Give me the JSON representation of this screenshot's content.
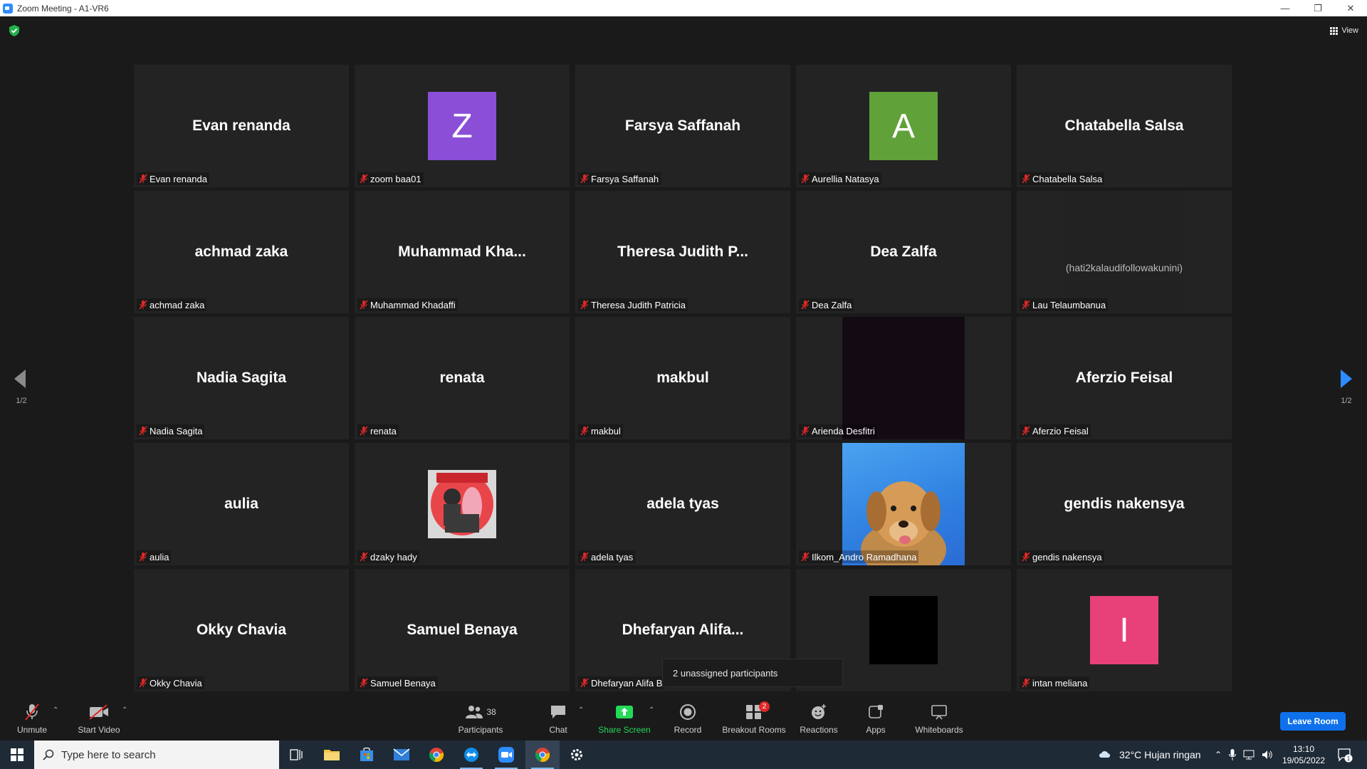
{
  "window": {
    "title": "Zoom Meeting - A1-VR6"
  },
  "top": {
    "view_label": "View"
  },
  "pager": {
    "left_count": "1/2",
    "right_count": "1/2"
  },
  "tiles": [
    {
      "big": "Evan renanda",
      "tag": "Evan renanda"
    },
    {
      "avatar_letter": "Z",
      "avatar_color": "#8a4fd6",
      "tag": "zoom baa01"
    },
    {
      "big": "Farsya Saffanah",
      "tag": "Farsya Saffanah"
    },
    {
      "avatar_letter": "A",
      "avatar_color": "#61a13a",
      "tag": "Aurellia Natasya"
    },
    {
      "big": "Chatabella Salsa",
      "tag": "Chatabella Salsa"
    },
    {
      "big": "achmad zaka",
      "tag": "achmad zaka"
    },
    {
      "big": "Muhammad  Kha...",
      "tag": "Muhammad Khadaffi"
    },
    {
      "big": "Theresa Judith P...",
      "tag": "Theresa Judith Patricia"
    },
    {
      "big": "Dea Zalfa",
      "tag": "Dea Zalfa"
    },
    {
      "video_text": "(hati2kalaudifollowakunini)",
      "tag": "Lau Telaumbanua"
    },
    {
      "big": "Nadia Sagita",
      "tag": "Nadia Sagita"
    },
    {
      "big": "renata",
      "tag": "renata"
    },
    {
      "big": "makbul",
      "tag": "makbul"
    },
    {
      "video": "dark",
      "tag": "Arienda Desfitri"
    },
    {
      "big": "Aferzio Feisal",
      "tag": "Aferzio Feisal"
    },
    {
      "big": "aulia",
      "tag": "aulia"
    },
    {
      "picture": "persija",
      "tag": "dzaky hady"
    },
    {
      "big": "adela tyas",
      "tag": "adela tyas"
    },
    {
      "video": "dog",
      "tag": "Ilkom_Andro Ramadhana"
    },
    {
      "big": "gendis nakensya",
      "tag": "gendis nakensya"
    },
    {
      "big": "Okky Chavia",
      "tag": "Okky Chavia"
    },
    {
      "big": "Samuel Benaya",
      "tag": "Samuel Benaya"
    },
    {
      "big": "Dhefaryan  Alifa...",
      "tag": "Dhefaryan Alifa B"
    },
    {
      "avatar_letter": "",
      "avatar_color": "#000000"
    },
    {
      "avatar_letter": "I",
      "avatar_color": "#e8417a",
      "tag": "intan meliana"
    }
  ],
  "popup": {
    "text": "2 unassigned participants"
  },
  "toolbar": {
    "unmute": "Unmute",
    "start_video": "Start Video",
    "participants": "Participants",
    "participants_count": "38",
    "chat": "Chat",
    "share_screen": "Share Screen",
    "record": "Record",
    "breakout_rooms": "Breakout Rooms",
    "breakout_badge": "2",
    "reactions": "Reactions",
    "apps": "Apps",
    "whiteboards": "Whiteboards",
    "leave_room": "Leave Room",
    "accent_share": "#23d959",
    "accent_leave": "#0e71eb"
  },
  "taskbar": {
    "search_placeholder": "Type here to search",
    "weather": "32°C  Hujan ringan",
    "time": "13:10",
    "date": "19/05/2022",
    "notification_count": "1"
  }
}
